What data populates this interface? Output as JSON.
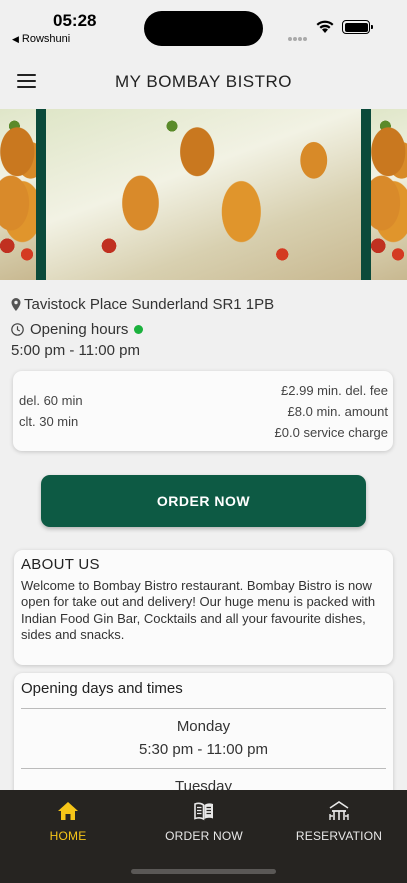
{
  "status_bar": {
    "time": "05:28",
    "back_app": "Rowshuni"
  },
  "header": {
    "title": "MY BOMBAY BISTRO",
    "menu_icon": "hamburger-menu-icon"
  },
  "restaurant": {
    "address": "Tavistock Place  Sunderland  SR1 1PB",
    "opening_label": "Opening hours",
    "open_status_color": "#1bb13d",
    "hours": "5:00 pm - 11:00 pm"
  },
  "delivery": {
    "del_time": "del. 60 min",
    "clt_time": "clt. 30 min",
    "min_del_fee": "£2.99 min. del. fee",
    "min_amount": "£8.0 min. amount",
    "service_charge": "£0.0 service charge"
  },
  "order_button": {
    "label": "ORDER NOW",
    "color": "#0d5a44"
  },
  "about": {
    "title": "ABOUT US",
    "text": "Welcome to Bombay Bistro restaurant. Bombay Bistro is now open for take out and delivery! Our huge menu is packed with Indian Food Gin Bar, Cocktails and all your favourite dishes, sides and snacks."
  },
  "opening_days": {
    "title": "Opening days and times",
    "days": [
      {
        "day": "Monday",
        "time": "5:30 pm - 11:00 pm"
      },
      {
        "day": "Tuesday",
        "time": ""
      }
    ]
  },
  "bottom_nav": {
    "items": [
      {
        "label": "HOME",
        "icon": "home-icon",
        "active": true
      },
      {
        "label": "ORDER NOW",
        "icon": "menu-book-icon",
        "active": false
      },
      {
        "label": "RESERVATION",
        "icon": "table-reservation-icon",
        "active": false
      }
    ],
    "active_color": "#f5c518"
  }
}
